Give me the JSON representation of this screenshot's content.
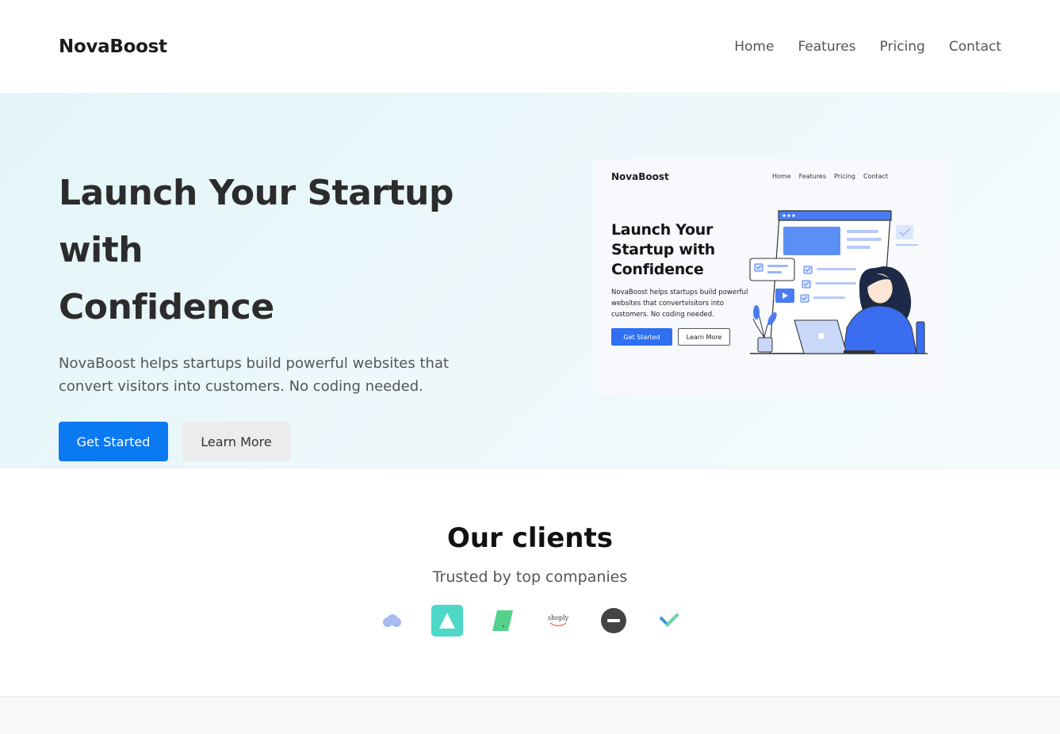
{
  "header": {
    "brand": "NovaBoost",
    "nav": [
      "Home",
      "Features",
      "Pricing",
      "Contact"
    ]
  },
  "hero": {
    "title_line1": "Launch Your Startup with",
    "title_line2": "Confidence",
    "subtitle": "NovaBoost helps startups build powerful websites that convert visitors into customers. No coding needed.",
    "primary_button": "Get Started",
    "secondary_button": "Learn More"
  },
  "preview": {
    "brand": "NovaBoost",
    "nav": [
      "Home",
      "Features",
      "Pricing",
      "Contact"
    ],
    "title": "Launch Your Startup with Confidence",
    "subtitle": "NovaBoost helps startups build powerful websites that convertvisitors into customers. No coding needed.",
    "primary_button": "Get Started",
    "secondary_button": "Learn More"
  },
  "clients": {
    "title": "Our clients",
    "subtitle": "Trusted by top companies",
    "logos": [
      {
        "name": "cloud-logo-icon",
        "color": "#a9b9f2"
      },
      {
        "name": "triangle-logo-icon",
        "color": "#4dd8c7"
      },
      {
        "name": "parallelogram-logo-icon",
        "color": "#54d18b"
      },
      {
        "name": "shoply-logo-icon",
        "text": "shoply",
        "color": "#e8663d"
      },
      {
        "name": "minus-circle-logo-icon",
        "color": "#444444"
      },
      {
        "name": "checkmark-logo-icon",
        "color": "#3b9ad9"
      }
    ]
  },
  "colors": {
    "accent": "#0b79f2",
    "hero_bg": "#e3f5f8"
  }
}
